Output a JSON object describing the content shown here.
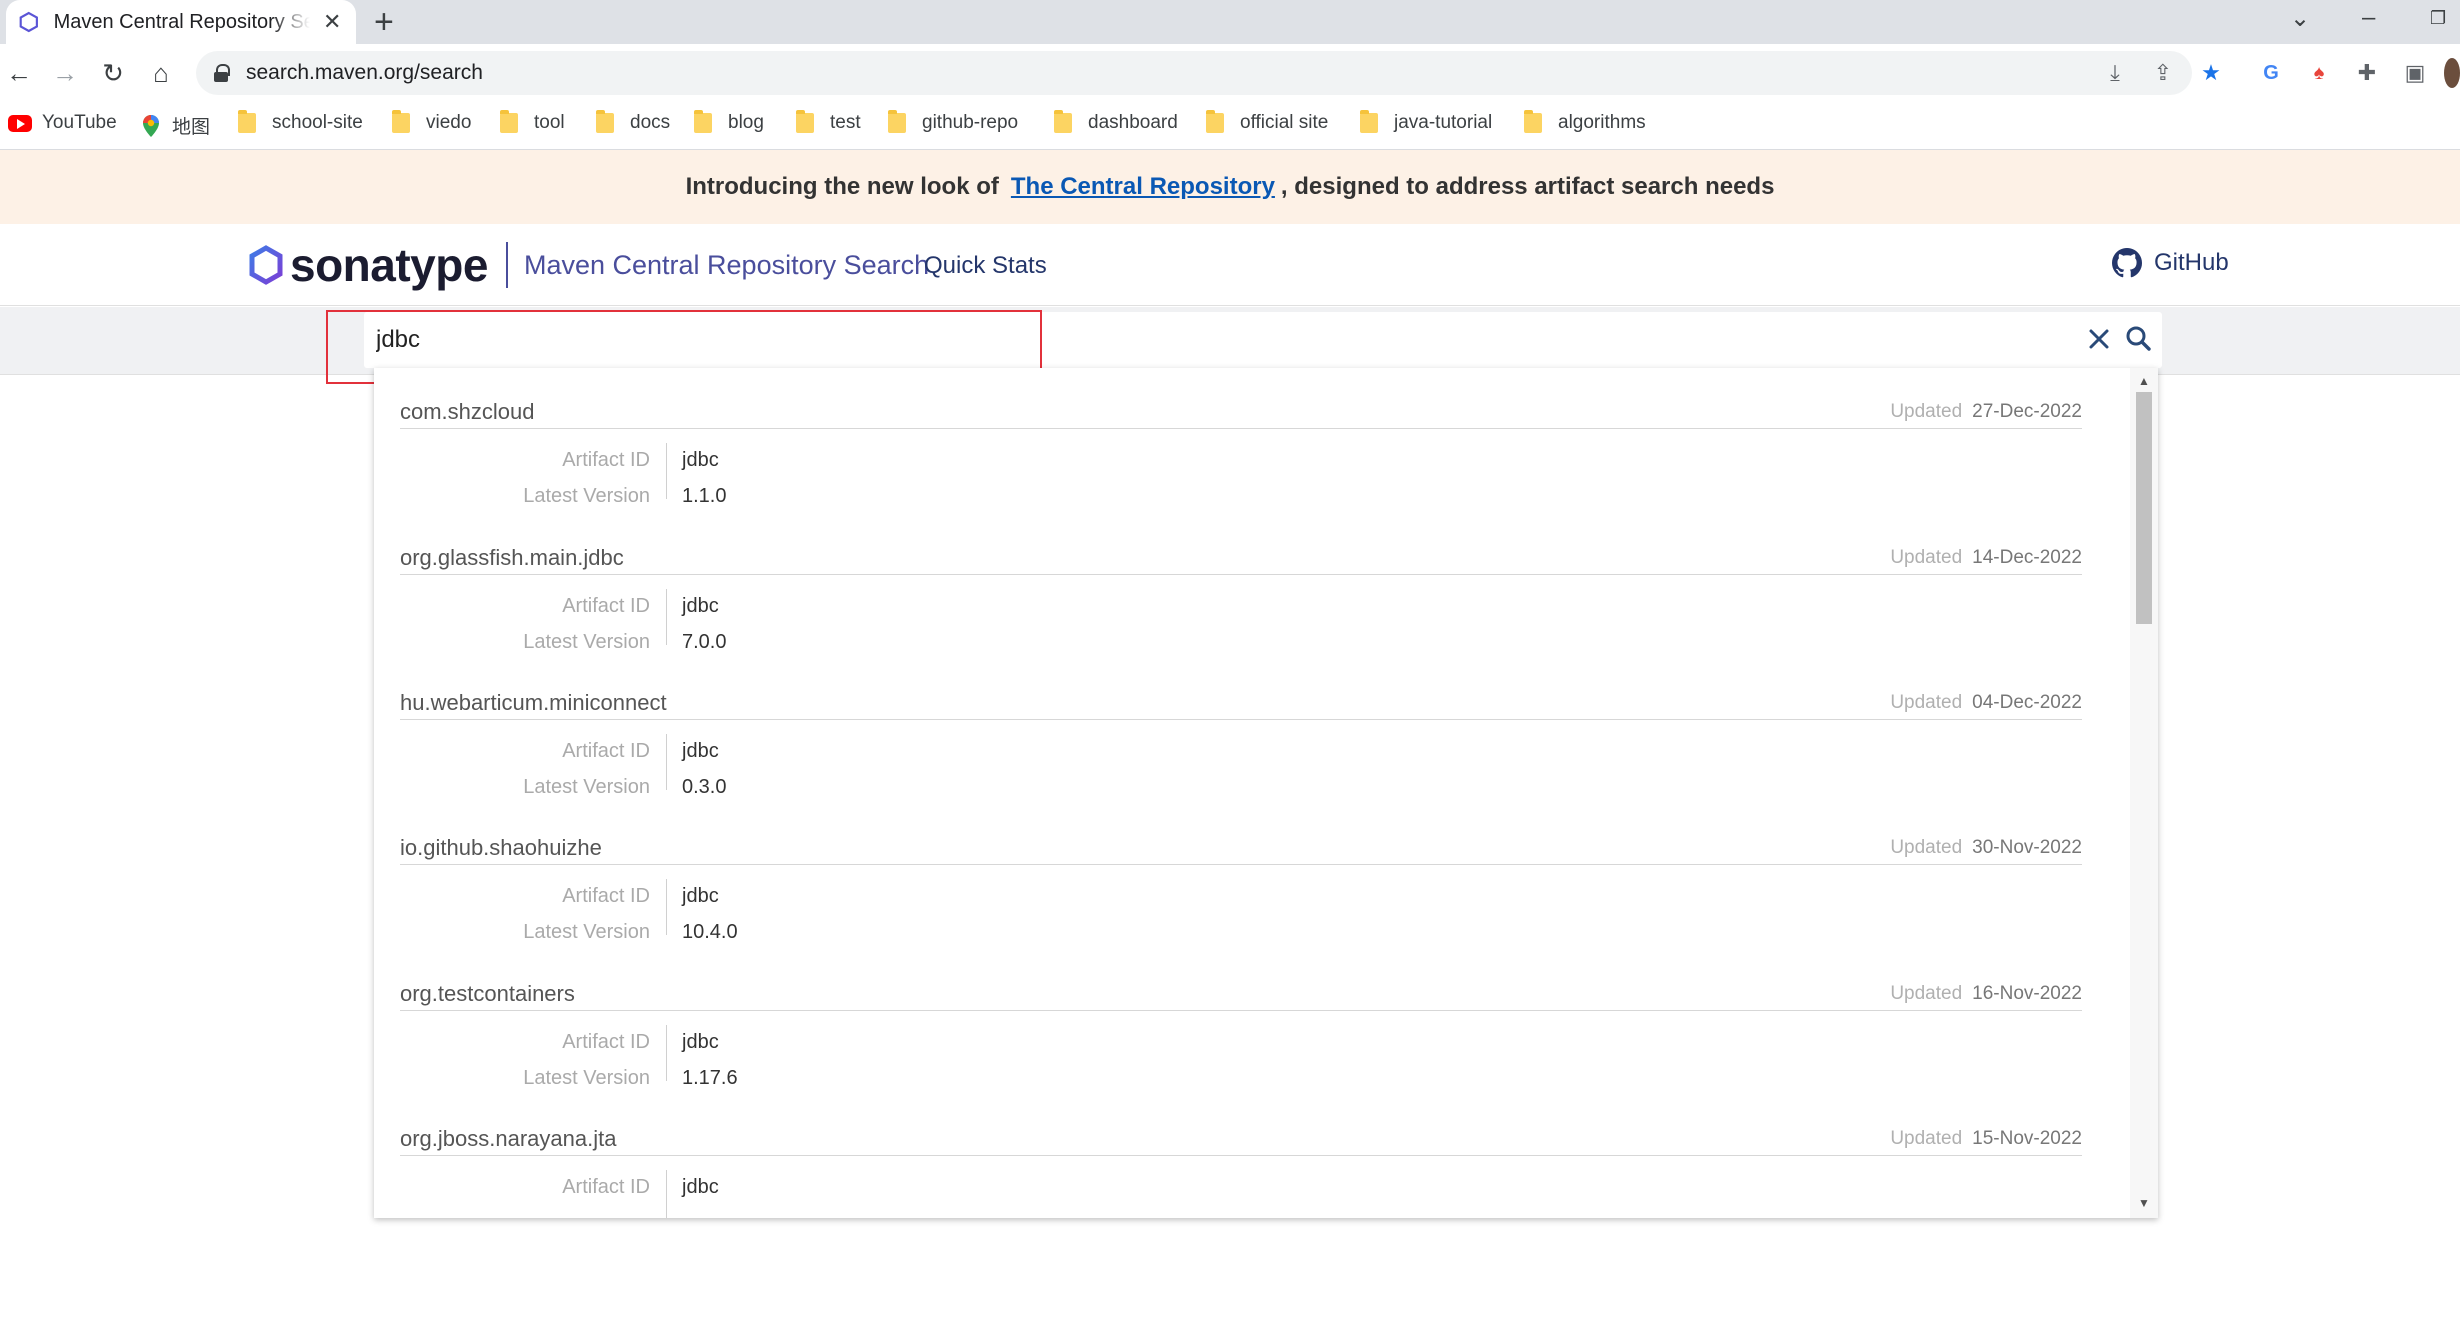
{
  "browser": {
    "tab_title": "Maven Central Repository Search",
    "tab_favicon": "sonatype-hex-icon",
    "url": "search.maven.org/search",
    "bookmarks": [
      {
        "label": "YouTube",
        "icon": "youtube-icon"
      },
      {
        "label": "地图",
        "icon": "maps-icon"
      },
      {
        "label": "school-site",
        "icon": "folder-icon"
      },
      {
        "label": "viedo",
        "icon": "folder-icon"
      },
      {
        "label": "tool",
        "icon": "folder-icon"
      },
      {
        "label": "docs",
        "icon": "folder-icon"
      },
      {
        "label": "blog",
        "icon": "folder-icon"
      },
      {
        "label": "test",
        "icon": "folder-icon"
      },
      {
        "label": "github-repo",
        "icon": "folder-icon"
      },
      {
        "label": "dashboard",
        "icon": "folder-icon"
      },
      {
        "label": "official site",
        "icon": "folder-icon"
      },
      {
        "label": "java-tutorial",
        "icon": "folder-icon"
      },
      {
        "label": "algorithms",
        "icon": "folder-icon"
      }
    ]
  },
  "announcement": {
    "prefix": "Introducing the new look of",
    "link": "The Central Repository",
    "suffix": ", designed to address artifact search needs"
  },
  "header": {
    "logo_text": "sonatype",
    "subtitle": "Maven Central Repository Search",
    "quick_stats": "Quick Stats",
    "github": "GitHub"
  },
  "search": {
    "value": "jdbc"
  },
  "labels": {
    "updated": "Updated",
    "artifact_id": "Artifact ID",
    "latest_version": "Latest Version"
  },
  "results": [
    {
      "group_id": "com.shzcloud",
      "updated": "27-Dec-2022",
      "artifact_id": "jdbc",
      "latest_version": "1.1.0"
    },
    {
      "group_id": "org.glassfish.main.jdbc",
      "updated": "14-Dec-2022",
      "artifact_id": "jdbc",
      "latest_version": "7.0.0"
    },
    {
      "group_id": "hu.webarticum.miniconnect",
      "updated": "04-Dec-2022",
      "artifact_id": "jdbc",
      "latest_version": "0.3.0"
    },
    {
      "group_id": "io.github.shaohuizhe",
      "updated": "30-Nov-2022",
      "artifact_id": "jdbc",
      "latest_version": "10.4.0"
    },
    {
      "group_id": "org.testcontainers",
      "updated": "16-Nov-2022",
      "artifact_id": "jdbc",
      "latest_version": "1.17.6"
    },
    {
      "group_id": "org.jboss.narayana.jta",
      "updated": "15-Nov-2022",
      "artifact_id": "jdbc",
      "latest_version": ""
    }
  ],
  "colors": {
    "announcement_bg": "#fdf1e6",
    "link": "#0a58b4",
    "brand_purple": "#4a4e9c",
    "highlight_red": "#e2313b"
  }
}
